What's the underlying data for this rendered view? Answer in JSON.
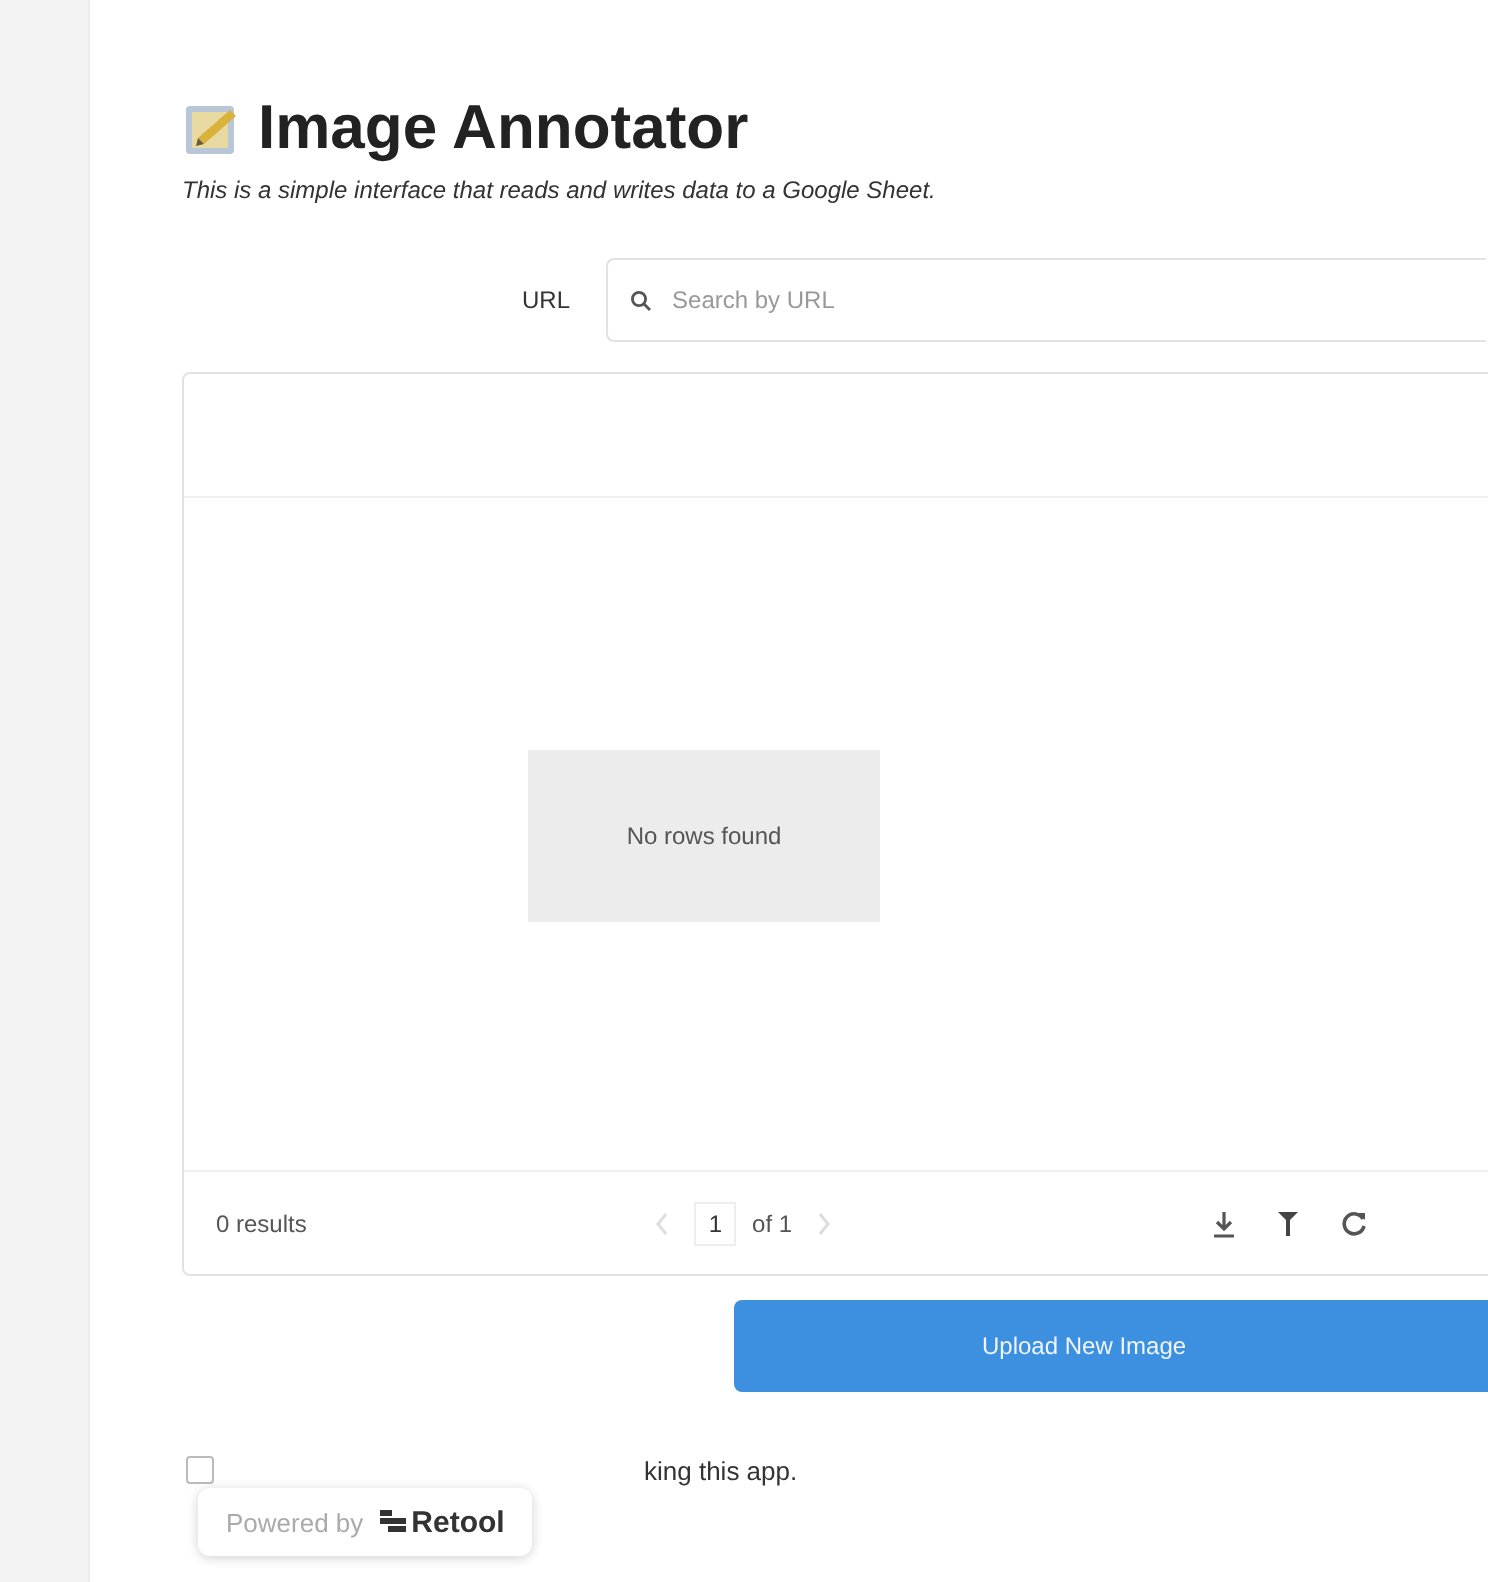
{
  "header": {
    "title": "Image Annotator",
    "subtitle": "This is a simple interface that reads and writes data to a Google Sheet."
  },
  "search": {
    "label": "URL",
    "placeholder": "Search by URL"
  },
  "table": {
    "empty_message": "No rows found",
    "results": "0 results",
    "pagination": {
      "page": "1",
      "of": "of 1",
      "prev_disabled": true,
      "next_disabled": true
    }
  },
  "upload_button": "Upload New Image",
  "notice": {
    "checked": false,
    "text": "king this app."
  },
  "badge": {
    "prefix": "Powered by",
    "brand": "Retool"
  }
}
